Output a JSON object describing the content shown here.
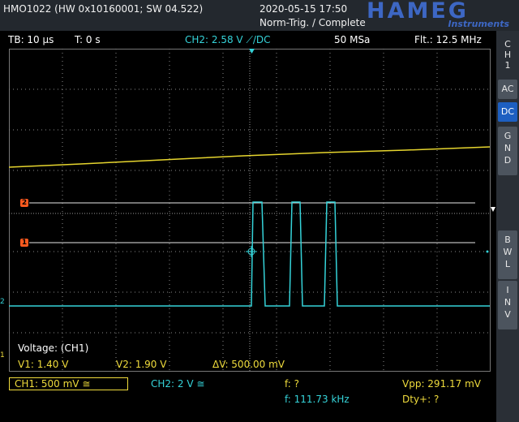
{
  "header": {
    "model_info": "HMO1022 (HW 0x10160001; SW 04.522)",
    "datetime": "2020-05-15 17:50",
    "trigger_status": "Norm-Trig. / Complete",
    "brand": "HAMEG",
    "brand_sub": "Instruments"
  },
  "status_bar": {
    "timebase": "TB: 10 µs",
    "trigger_time": "T: 0 s",
    "trigger_channel": "CH2: 2.58 V ⟋/DC",
    "sample_rate": "50 MSa",
    "filter": "Flt.: 12.5 MHz"
  },
  "side_menu": {
    "channel_label": [
      "C",
      "H",
      "1"
    ],
    "buttons": [
      {
        "label": "AC",
        "active": false
      },
      {
        "label": "DC",
        "active": true
      },
      {
        "label": "G\nN\nD",
        "active": false
      },
      {
        "label": "B\nW\nL",
        "active": false
      },
      {
        "label": "I\nN\nV",
        "active": false
      }
    ]
  },
  "cursor_markers": {
    "marker2": "2",
    "marker1": "1"
  },
  "measurement": {
    "title": "Voltage: (CH1)",
    "v1": "V1: 1.40 V",
    "v2": "V2: 1.90 V",
    "delta": "ΔV: 500.00 mV"
  },
  "bottom_bar": {
    "ch1": "CH1: 500 mV ≅",
    "ch2": "CH2: 2 V ≅",
    "freq1": "f: ?",
    "freq2": "f: 111.73 kHz",
    "vpp": "Vpp: 291.17 mV",
    "duty": "Dty+: ?"
  },
  "colors": {
    "ch1": "#f0dc3c",
    "ch2": "#35d3d9",
    "active_button": "#1d5fc1",
    "cursor_marker": "#ff5a1e"
  }
}
